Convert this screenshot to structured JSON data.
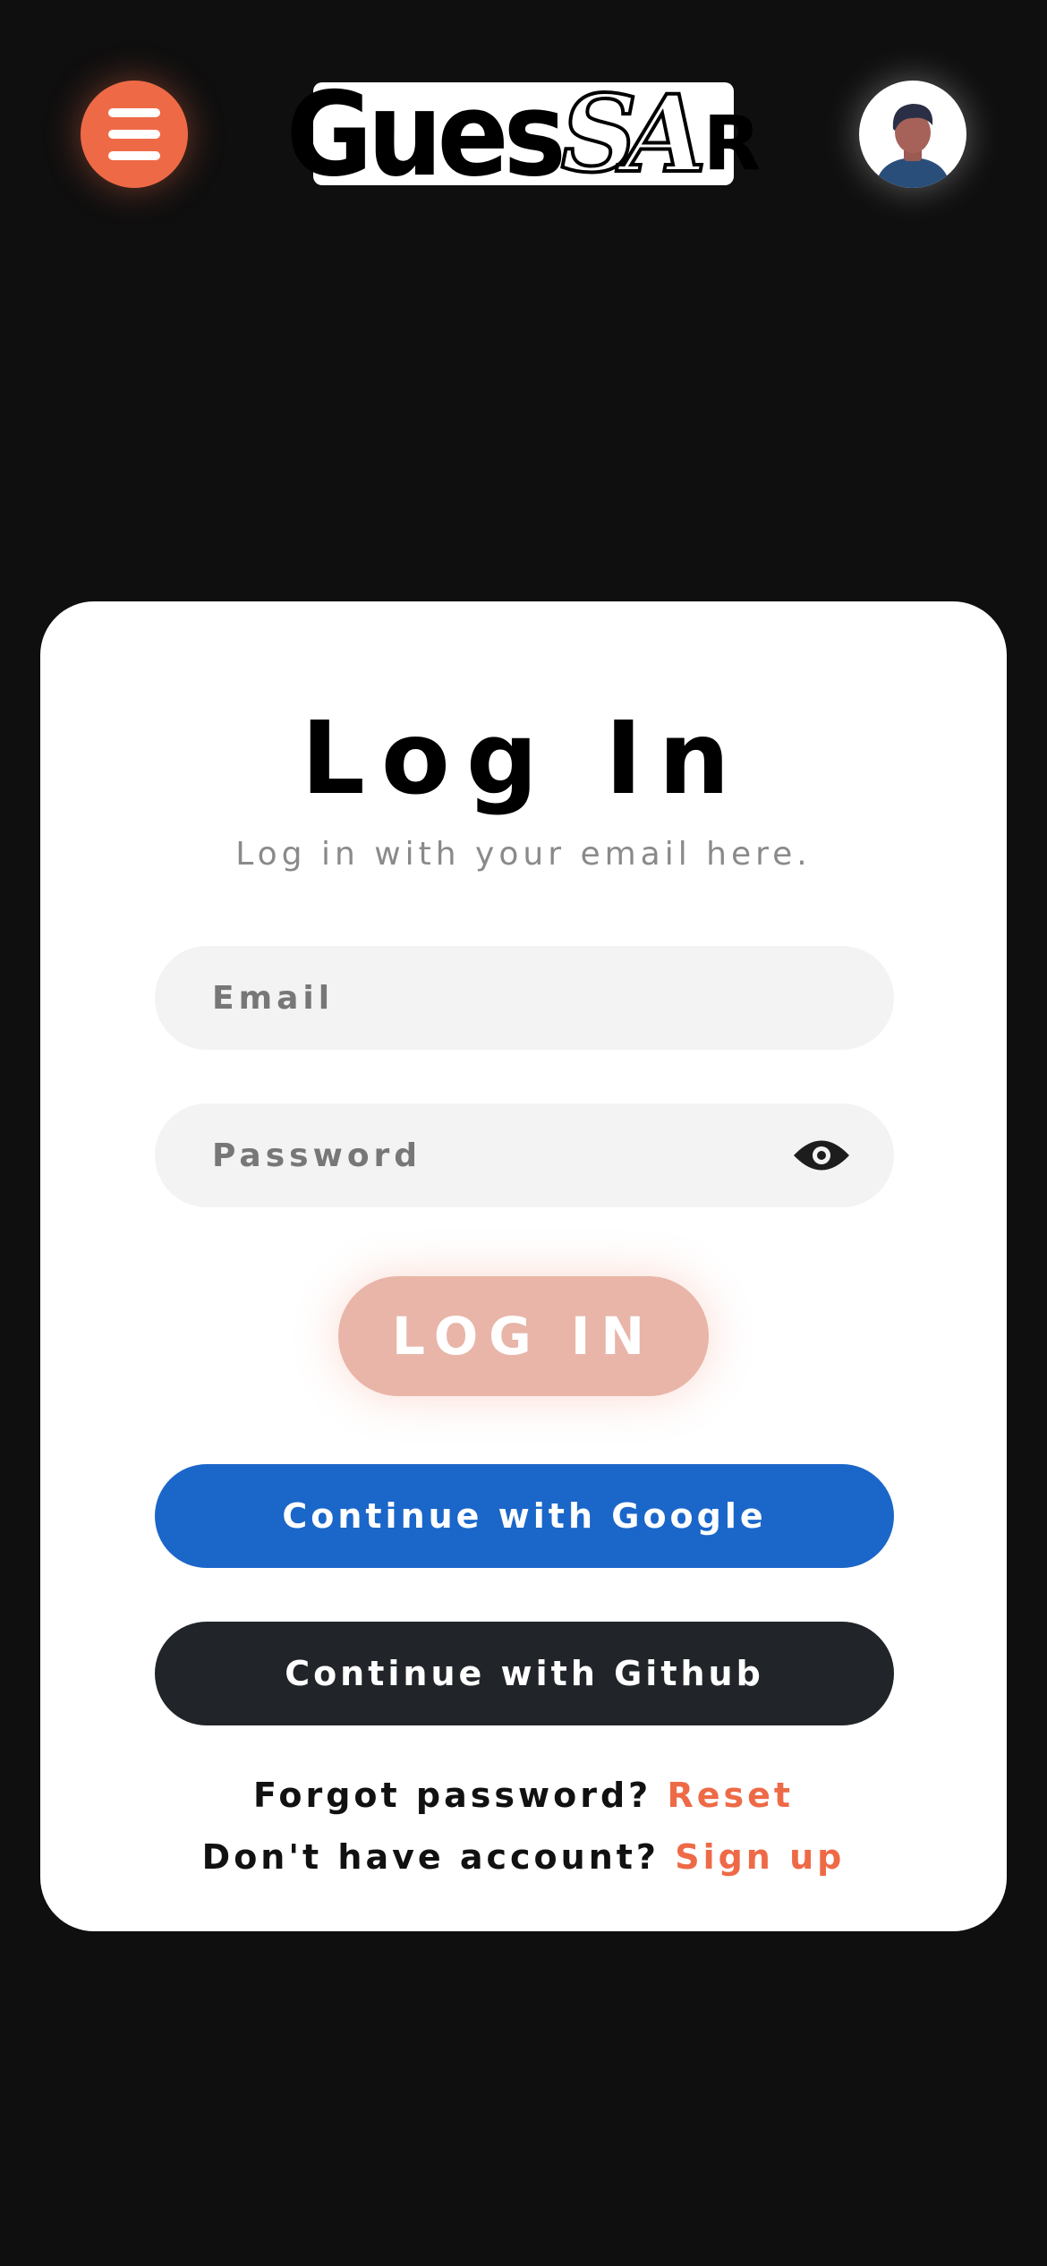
{
  "header": {
    "menu_icon": "hamburger-menu-icon",
    "logo_part1": "Gues",
    "logo_part2": "SA",
    "logo_part3": "R",
    "avatar_icon": "user-avatar-icon",
    "accent_color": "#ee6a47"
  },
  "login": {
    "title": "Log In",
    "subtitle": "Log in with your email here.",
    "email_placeholder": "Email",
    "email_value": "",
    "password_placeholder": "Password",
    "password_value": "",
    "password_toggle_icon": "eye-icon",
    "submit_label": "LOG IN",
    "google_label": "Continue with Google",
    "github_label": "Continue with Github",
    "forgot_text": "Forgot password?",
    "reset_link": "Reset",
    "no_account_text": "Don't have account?",
    "signup_link": "Sign up"
  },
  "colors": {
    "google": "#1b66c9",
    "github": "#212529",
    "submit_disabled": "#e8b5a8"
  }
}
